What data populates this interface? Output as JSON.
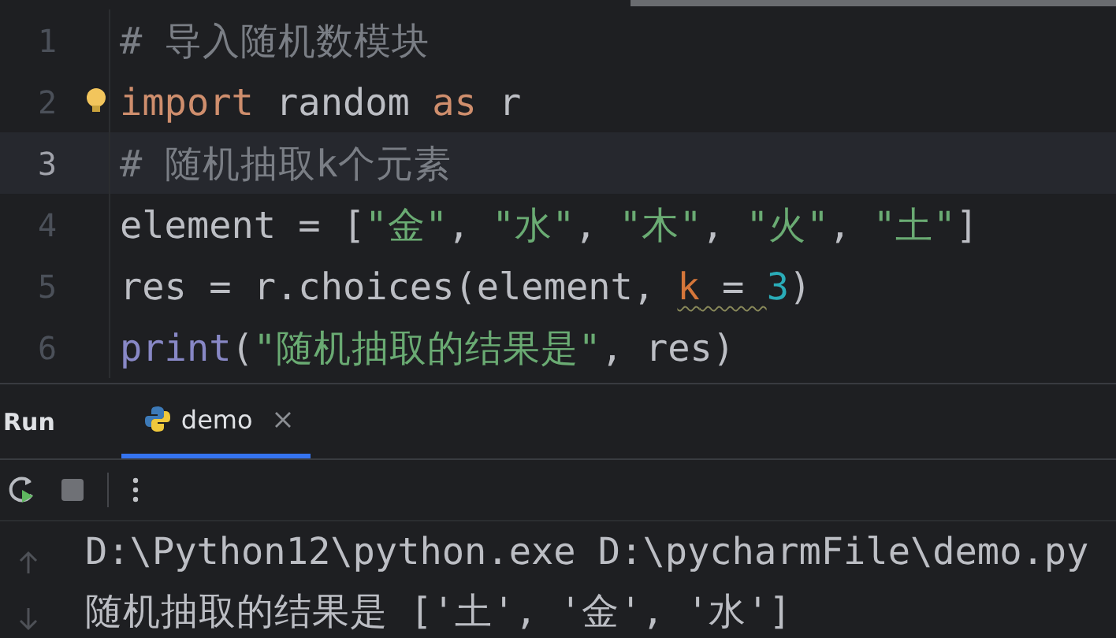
{
  "editor": {
    "lines": [
      {
        "number": "1",
        "current": false,
        "tokens": [
          {
            "kind": "comment",
            "text": "# 导入随机数模块"
          }
        ]
      },
      {
        "number": "2",
        "current": false,
        "bulb": true,
        "tokens": [
          {
            "kind": "keyword",
            "text": "import"
          },
          {
            "kind": "plain",
            "text": " random "
          },
          {
            "kind": "keyword",
            "text": "as"
          },
          {
            "kind": "plain",
            "text": " r"
          }
        ]
      },
      {
        "number": "3",
        "current": true,
        "tokens": [
          {
            "kind": "comment",
            "text": "# 随机抽取k个元素"
          }
        ]
      },
      {
        "number": "4",
        "current": false,
        "tokens": [
          {
            "kind": "plain",
            "text": "element = ["
          },
          {
            "kind": "string",
            "text": "\"金\""
          },
          {
            "kind": "plain",
            "text": ", "
          },
          {
            "kind": "string",
            "text": "\"水\""
          },
          {
            "kind": "plain",
            "text": ", "
          },
          {
            "kind": "string",
            "text": "\"木\""
          },
          {
            "kind": "plain",
            "text": ", "
          },
          {
            "kind": "string",
            "text": "\"火\""
          },
          {
            "kind": "plain",
            "text": ", "
          },
          {
            "kind": "string",
            "text": "\"土\""
          },
          {
            "kind": "plain",
            "text": "]"
          }
        ]
      },
      {
        "number": "5",
        "current": false,
        "tokens": [
          {
            "kind": "plain",
            "text": "res = r.choices(element, "
          },
          {
            "kind": "param",
            "text": "k",
            "warning": true
          },
          {
            "kind": "plain",
            "text": " = ",
            "warning": true
          },
          {
            "kind": "number",
            "text": "3"
          },
          {
            "kind": "plain",
            "text": ")"
          }
        ]
      },
      {
        "number": "6",
        "current": false,
        "tokens": [
          {
            "kind": "builtin",
            "text": "print"
          },
          {
            "kind": "plain",
            "text": "("
          },
          {
            "kind": "string",
            "text": "\"随机抽取的结果是\""
          },
          {
            "kind": "plain",
            "text": ", res)"
          }
        ]
      }
    ]
  },
  "run_panel": {
    "title": "Run",
    "tabs": [
      {
        "label": "demo",
        "selected": true,
        "closable": true
      }
    ],
    "console": [
      "D:\\Python12\\python.exe D:\\pycharmFile\\demo.py",
      "随机抽取的结果是 ['土', '金', '水']"
    ]
  }
}
